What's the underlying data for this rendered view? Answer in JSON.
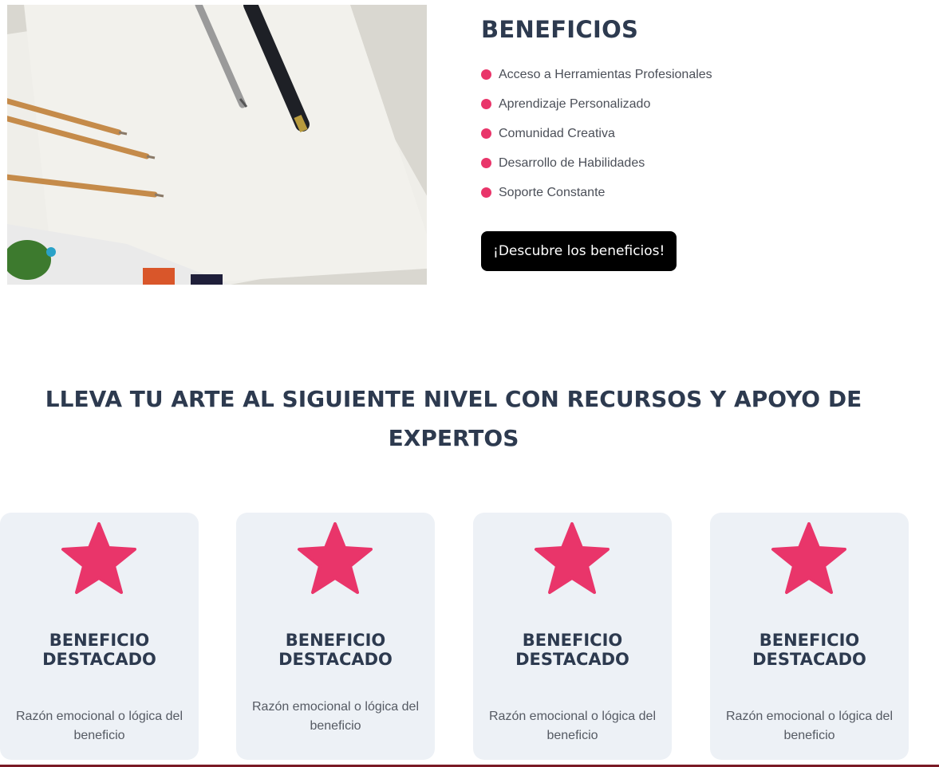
{
  "hero": {
    "image_alt": "Pinceles, plumas y papel de acuarela sobre una mesa"
  },
  "benefits": {
    "title": "BENEFICIOS",
    "items": [
      "Acceso a Herramientas Profesionales",
      "Aprendizaje Personalizado",
      "Comunidad Creativa",
      "Desarrollo de Habilidades",
      "Soporte Constante"
    ],
    "cta_label": "¡Descubre los beneficios!"
  },
  "section": {
    "heading": "LLEVA TU ARTE AL SIGUIENTE NIVEL CON RECURSOS Y APOYO DE EXPERTOS"
  },
  "cards": [
    {
      "icon": "star-icon",
      "title": "BENEFICIO DESTACADO",
      "text": "Razón emocional o lógica del beneficio"
    },
    {
      "icon": "star-icon",
      "title": "BENEFICIO DESTACADO",
      "text": "Razón emocional o lógica del beneficio"
    },
    {
      "icon": "star-icon",
      "title": "BENEFICIO DESTACADO",
      "text": "Razón emocional o lógica del beneficio"
    },
    {
      "icon": "star-icon",
      "title": "BENEFICIO DESTACADO",
      "text": "Razón emocional o lógica del beneficio"
    }
  ],
  "colors": {
    "accent": "#e9356a",
    "heading": "#2d3a4f",
    "card_background": "#edf1f6",
    "button_background": "#000000"
  }
}
